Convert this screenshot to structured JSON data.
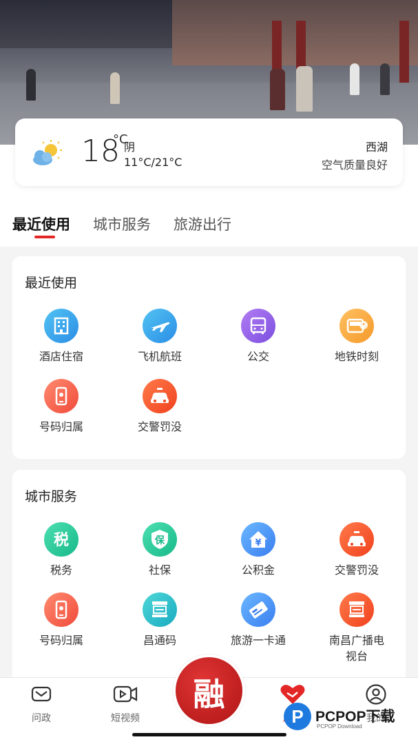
{
  "weather": {
    "temperature": "18",
    "unit": "°C",
    "condition": "阴",
    "range": "11°C/21°C",
    "city": "西湖",
    "air_quality": "空气质量良好",
    "icon": "partly-cloudy-icon"
  },
  "tabs": [
    {
      "label": "最近使用",
      "active": true
    },
    {
      "label": "城市服务",
      "active": false
    },
    {
      "label": "旅游出行",
      "active": false
    }
  ],
  "recent": {
    "title": "最近使用",
    "items": [
      {
        "label": "酒店住宿",
        "icon": "hotel-icon"
      },
      {
        "label": "飞机航班",
        "icon": "airplane-icon"
      },
      {
        "label": "公交",
        "icon": "bus-icon"
      },
      {
        "label": "地铁时刻",
        "icon": "subway-icon"
      },
      {
        "label": "号码归属",
        "icon": "phone-icon"
      },
      {
        "label": "交警罚没",
        "icon": "police-car-icon"
      }
    ]
  },
  "city_services": {
    "title": "城市服务",
    "items": [
      {
        "label": "税务",
        "icon": "tax-icon",
        "glyph": "税"
      },
      {
        "label": "社保",
        "icon": "social-security-icon",
        "glyph": "保"
      },
      {
        "label": "公积金",
        "icon": "housing-fund-icon",
        "glyph": "¥"
      },
      {
        "label": "交警罚没",
        "icon": "police-car-icon"
      },
      {
        "label": "号码归属",
        "icon": "phone-icon"
      },
      {
        "label": "昌通码",
        "icon": "qr-code-icon"
      },
      {
        "label": "旅游一卡通",
        "icon": "travel-card-icon"
      },
      {
        "label": "南昌广播电视台",
        "icon": "tv-station-icon"
      }
    ]
  },
  "bottom_nav": {
    "items": [
      {
        "label": "问政",
        "icon": "message-icon"
      },
      {
        "label": "短视频",
        "icon": "video-icon"
      },
      {
        "label": "服务",
        "icon": "heart-hands-icon"
      },
      {
        "label": "我的",
        "icon": "user-icon"
      }
    ],
    "center_glyph": "融"
  },
  "watermark": {
    "logo": "P",
    "title": "PCPOP下载",
    "subtitle": "PCPOP Download"
  },
  "colors": {
    "accent": "#e32626",
    "background": "#f4f4f4"
  }
}
